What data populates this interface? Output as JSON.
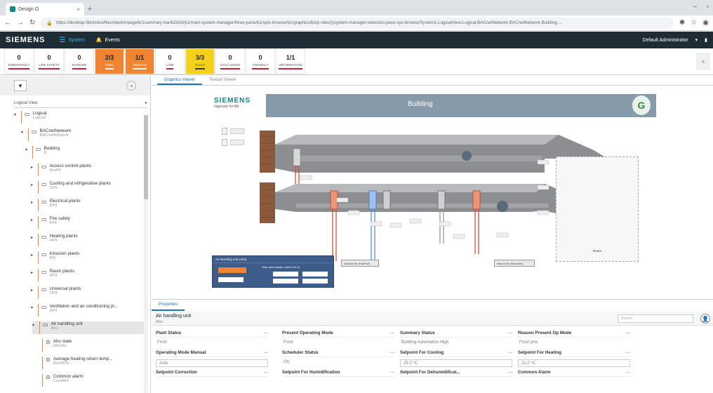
{
  "browser": {
    "tab_title": "Design O",
    "url": "https://desktop-5bnlzdco/flex/client/#/page/b/1summary-bar/b2/b2t(b1/main:system-manager/three-pane/b1/spic-browse/b1/graphics/b2/p-view/)(system-manager:selection-pane:sys-browse/System1:LogicalView:Logical:BACnetNetwork:BACnetNetwork.Building:..."
  },
  "app": {
    "logo": "SIEMENS",
    "system_label": "System",
    "events_label": "Events",
    "user": "Default Administrator"
  },
  "summary": [
    {
      "value": "0",
      "label": "EMERGENCY",
      "style": "normal"
    },
    {
      "value": "0",
      "label": "LIFE SAFETY",
      "style": "normal"
    },
    {
      "value": "0",
      "label": "DANGER",
      "style": "normal"
    },
    {
      "value": "2/3",
      "label": "HIGH",
      "style": "high"
    },
    {
      "value": "1/1",
      "label": "MEDIUM",
      "style": "high"
    },
    {
      "value": "0",
      "label": "LOW",
      "style": "normal"
    },
    {
      "value": "3/3",
      "label": "FAULT",
      "style": "fault"
    },
    {
      "value": "0",
      "label": "EXCLUSION",
      "style": "normal"
    },
    {
      "value": "0",
      "label": "ANOMALY",
      "style": "normal"
    },
    {
      "value": "1/1",
      "label": "INFORMATION",
      "style": "normal"
    }
  ],
  "left": {
    "view_select": "Logical View",
    "tree": [
      {
        "title": "Logical",
        "sub": "Logical",
        "level": 0,
        "arrow": "▾"
      },
      {
        "title": "BACnetNetwork",
        "sub": "BACnetNetwork",
        "level": 1,
        "arrow": "▾"
      },
      {
        "title": "Building",
        "sub": "B",
        "level": 2,
        "arrow": "▾"
      },
      {
        "title": "Access control plants",
        "sub": "AcsPlt",
        "level": 3,
        "arrow": "▸"
      },
      {
        "title": "Cooling and refrigerative plants",
        "sub": "CPlt",
        "level": 3,
        "arrow": "▸"
      },
      {
        "title": "Electrical plants",
        "sub": "EPlt",
        "level": 3,
        "arrow": "▸"
      },
      {
        "title": "Fire safety",
        "sub": "FPlt",
        "level": 3,
        "arrow": "▸"
      },
      {
        "title": "Heating plants",
        "sub": "HPlt",
        "level": 3,
        "arrow": "▸"
      },
      {
        "title": "Intrusion plants",
        "sub": "IPlt",
        "level": 3,
        "arrow": "▸"
      },
      {
        "title": "Raum plants",
        "sub": "RPlt",
        "level": 3,
        "arrow": "▸"
      },
      {
        "title": "Universal plants",
        "sub": "UPlt",
        "level": 3,
        "arrow": "▸"
      },
      {
        "title": "Ventilation and air conditioning pl...",
        "sub": "APlt",
        "level": 3,
        "arrow": "▾"
      },
      {
        "title": "Air handling unit",
        "sub": "Ahu",
        "level": 4,
        "arrow": "▾",
        "selected": true
      },
      {
        "title": "Ahu state",
        "sub": "AhuSta",
        "level": 5,
        "arrow": ""
      },
      {
        "title": "Average heating return temp...",
        "sub": "AvrHRTe",
        "level": 5,
        "arrow": ""
      },
      {
        "title": "Common alarm",
        "sub": "ComAlm",
        "level": 5,
        "arrow": ""
      }
    ]
  },
  "viewer": {
    "tabs": [
      "Graphics Viewer",
      "Textual Viewer"
    ],
    "brand": "SIEMENS",
    "tagline": "Ingenuity for life",
    "title": "Building",
    "panel_title": "Air handling unit (Ahu)",
    "panel_sub": "Setp and transfer control (S.X)",
    "room_label": "Room",
    "chips": [
      "Outside Air (FanPwr)",
      "Return Air (Reactive)"
    ]
  },
  "properties": {
    "tab": "Properties",
    "object_title": "Air handling unit",
    "object_sub": "Ahu",
    "search_placeholder": "Search",
    "items": [
      {
        "label": "Plant Status",
        "value": "Frost",
        "box": false
      },
      {
        "label": "Present Operating Mode",
        "value": "Frost",
        "box": false
      },
      {
        "label": "Summary Status",
        "value": "Building Automation High",
        "box": false
      },
      {
        "label": "Reason Present Op Mode",
        "value": "Frost prot.",
        "box": false
      },
      {
        "label": "Operating Mode Manual",
        "value": "Auto",
        "box": true
      },
      {
        "label": "Scheduler Status",
        "value": "On",
        "box": false
      },
      {
        "label": "Setpoint For Cooling",
        "value": "25.0 °C",
        "box": true
      },
      {
        "label": "Setpoint For Heating",
        "value": "21.0 °C",
        "box": true
      },
      {
        "label": "Setpoint Correction",
        "value": "",
        "box": false
      },
      {
        "label": "Setpoint For Humidification",
        "value": "",
        "box": false
      },
      {
        "label": "Setpoint For Dehumidificat...",
        "value": "",
        "box": false
      },
      {
        "label": "Common Alarm",
        "value": "",
        "box": false
      }
    ]
  }
}
